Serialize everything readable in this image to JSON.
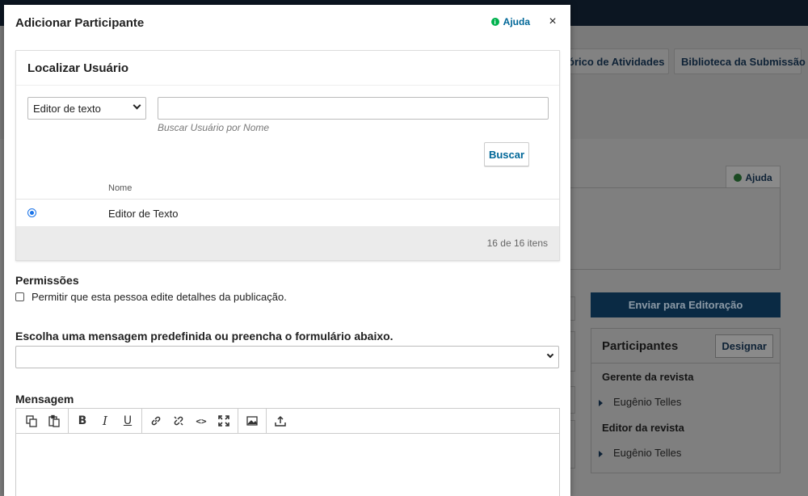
{
  "background": {
    "tabs": [
      "órico de Atividades",
      "Biblioteca da Submissão"
    ],
    "help_label": "Ajuda",
    "primary_button": "Enviar para Editoração",
    "participants": {
      "title": "Participantes",
      "assign_button": "Designar",
      "groups": [
        {
          "role": "Gerente da revista",
          "person": "Eugênio Telles"
        },
        {
          "role": "Editor da revista",
          "person": "Eugênio Telles"
        }
      ]
    }
  },
  "modal": {
    "title": "Adicionar Participante",
    "help_label": "Ajuda",
    "close_label": "×",
    "search": {
      "title": "Localizar Usuário",
      "role_select_value": "Editor de texto",
      "input_value": "",
      "input_hint": "Buscar Usuário por Nome",
      "search_button": "Buscar",
      "column_header": "Nome",
      "rows": [
        {
          "name": "Editor de Texto",
          "selected": true
        }
      ],
      "pager": "16 de 16 itens"
    },
    "permissions": {
      "label": "Permissões",
      "checkbox_label": "Permitir que esta pessoa edite detalhes da publicação.",
      "checked": false
    },
    "template": {
      "label": "Escolha uma mensagem predefinida ou preencha o formulário abaixo.",
      "value": ""
    },
    "message": {
      "label": "Mensagem",
      "toolbar_icons": [
        "copy-icon",
        "paste-icon",
        "bold-icon",
        "italic-icon",
        "underline-icon",
        "link-icon",
        "unlink-icon",
        "code-icon",
        "fullscreen-icon",
        "image-icon",
        "upload-icon"
      ]
    }
  },
  "colors": {
    "accent": "#006798",
    "help_green": "#00b24e",
    "radio_blue": "#1a73e8",
    "topbar": "#0c1622"
  }
}
